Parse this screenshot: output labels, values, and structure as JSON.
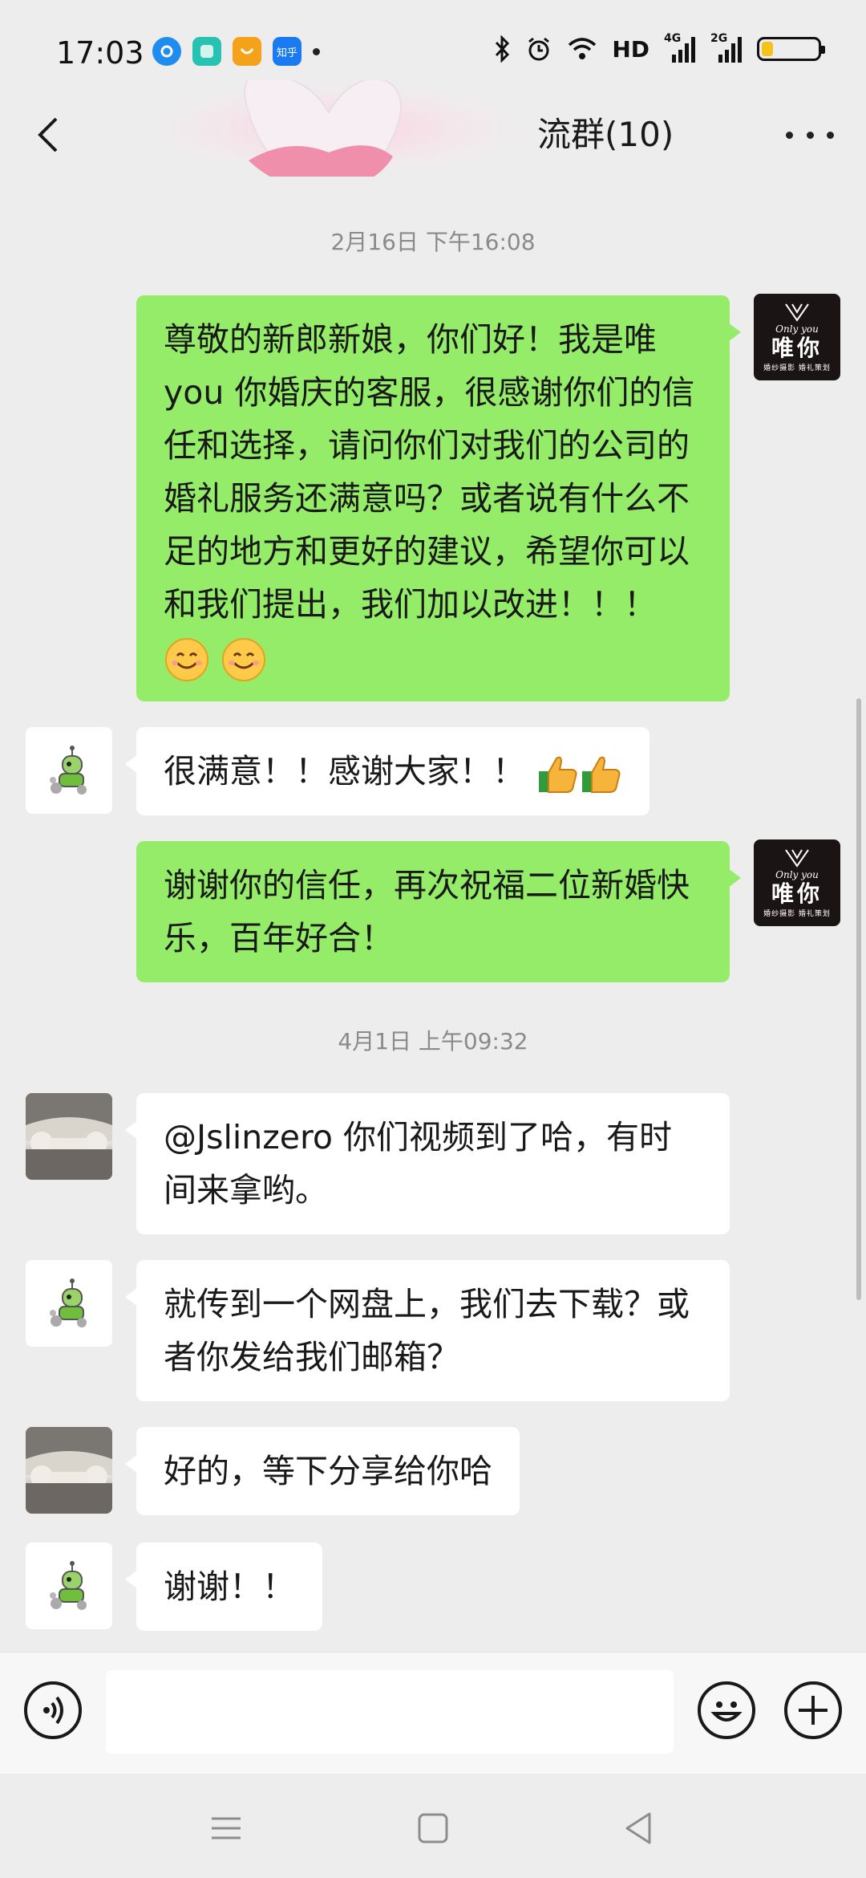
{
  "status_bar": {
    "time": "17:03",
    "app_icons": [
      {
        "name": "browser-icon",
        "color": "#1f8cf0",
        "label": ""
      },
      {
        "name": "gallery-icon",
        "color": "#27c2b1",
        "label": ""
      },
      {
        "name": "app-store-icon",
        "color": "#f3a21a",
        "label": ""
      },
      {
        "name": "zhihu-icon",
        "color": "#1a7bf1",
        "label": "知乎"
      }
    ],
    "network_label": "HD",
    "signal_1": "4G",
    "signal_2": "2G",
    "battery_level": 0.2,
    "battery_color": "#f4c21b"
  },
  "header": {
    "title": "流群(10)"
  },
  "messages": [
    {
      "type": "timestamp",
      "text": "2月16日 下午16:08"
    },
    {
      "sender": "me",
      "avatar": "only-you-logo",
      "text": "尊敬的新郎新娘，你们好！我是唯you 你婚庆的客服，很感谢你们的信任和选择，请问你们对我们的公司的婚礼服务还满意吗？或者说有什么不足的地方和更好的建议，希望你可以和我们提出，我们加以改进！！！",
      "emoji": [
        "smile-emoji",
        "smile-emoji"
      ]
    },
    {
      "sender": "other",
      "avatar": "robot-avatar",
      "text": "很满意！！感谢大家！！",
      "emoji": [
        "thumbs-up-emoji",
        "thumbs-up-emoji"
      ]
    },
    {
      "sender": "me",
      "avatar": "only-you-logo",
      "text": "谢谢你的信任，再次祝福二位新婚快乐，百年好合！"
    },
    {
      "type": "timestamp",
      "text": "4月1日 上午09:32"
    },
    {
      "sender": "other",
      "avatar": "wedding-photo-avatar",
      "text": "@Jslinzero 你们视频到了哈，有时间来拿哟。"
    },
    {
      "sender": "other",
      "avatar": "robot-avatar",
      "text": "就传到一个网盘上，我们去下载？或者你发给我们邮箱？"
    },
    {
      "sender": "other",
      "avatar": "wedding-photo-avatar",
      "text": "好的，等下分享给你哈"
    },
    {
      "sender": "other",
      "avatar": "robot-avatar",
      "text": "谢谢！！"
    }
  ],
  "logo": {
    "line1": "Only you",
    "line2": "唯你",
    "line3": "婚纱摄影 婚礼策划"
  },
  "input": {
    "value": "",
    "placeholder": ""
  },
  "colors": {
    "my_bubble": "#95ec69",
    "other_bubble": "#ffffff",
    "background": "#ededed"
  }
}
